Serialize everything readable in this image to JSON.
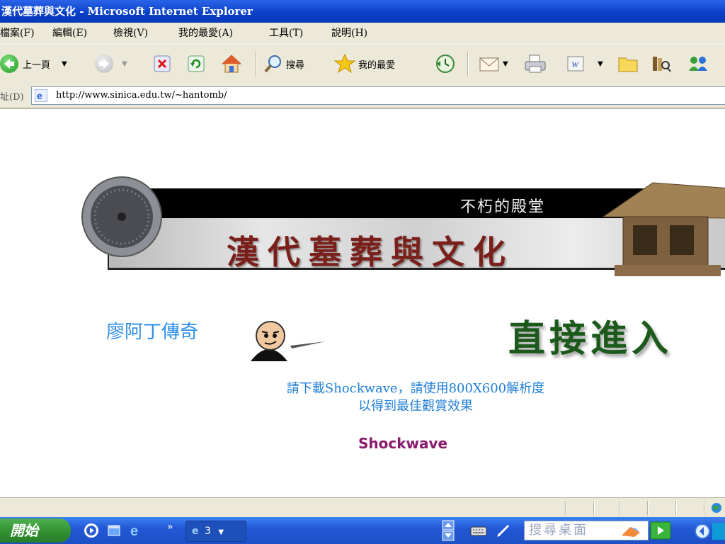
{
  "window": {
    "title": "漢代墓葬與文化 - Microsoft Internet Explorer"
  },
  "menu": {
    "items": [
      "檔案(F)",
      "編輯(E)",
      "檢視(V)",
      "我的最愛(A)",
      "工具(T)",
      "說明(H)"
    ]
  },
  "toolbar": {
    "back_label": "上一頁",
    "search_label": "搜尋",
    "favorites_label": "我的最愛"
  },
  "address": {
    "label": "址(D)",
    "url": "http://www.sinica.edu.tw/~hantomb/"
  },
  "page": {
    "banner_subtitle": "不朽的殿堂",
    "banner_title": "漢代墓葬與文化",
    "liao_link": "廖阿丁傳奇",
    "enter_link": "直接進入",
    "note_line1": "請下載Shockwave，請使用800X600解析度",
    "note_line2": "以得到最佳觀賞效果",
    "shockwave_link": "Shockwave"
  },
  "taskbar": {
    "start_label": "開始",
    "ie_count": "3",
    "search_desktop_placeholder": "搜尋桌面"
  },
  "colors": {
    "title_bar": "#0a3fc8",
    "banner_title": "#7a1f1a",
    "note_text": "#1e7ed6",
    "enter_link": "#1b5a1b",
    "shockwave_link": "#8a1a6a",
    "liao_link": "#2f8fe8"
  }
}
